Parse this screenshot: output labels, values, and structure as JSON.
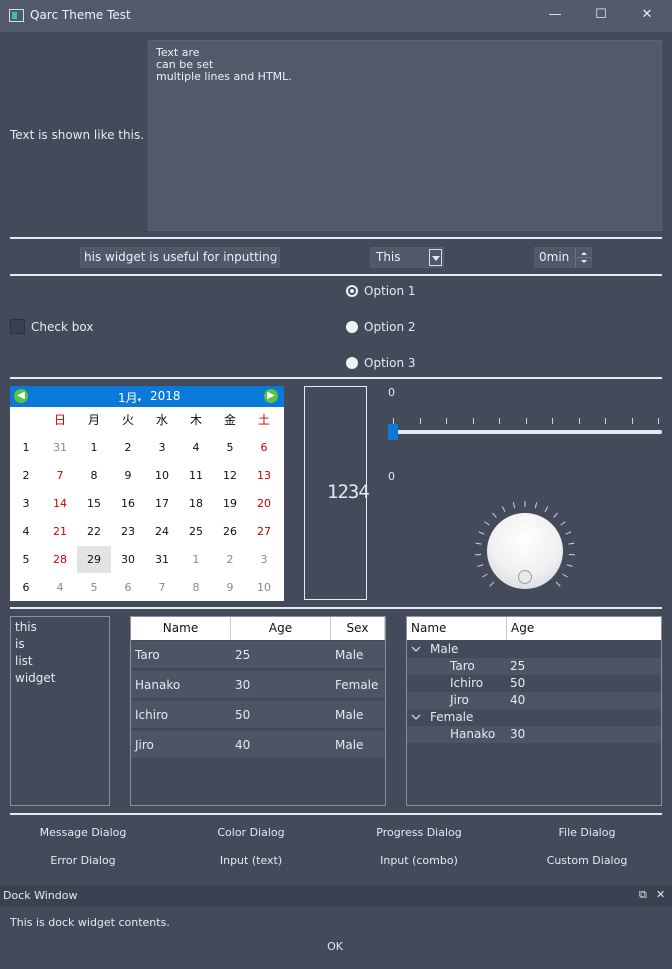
{
  "window": {
    "title": "Qarc Theme Test",
    "minimize": "—",
    "maximize": "☐",
    "close": "✕"
  },
  "label_text": "Text is shown like this.",
  "textedit_value": "Text are\ncan be set\nmultiple lines and HTML.",
  "line_edit_value": "his widget is useful for inputting text",
  "combo_value": "This",
  "spin_value": "0min",
  "checkbox_label": "Check box",
  "checkbox_checked": false,
  "radios": [
    {
      "label": "Option 1",
      "selected": true
    },
    {
      "label": "Option 2",
      "selected": false
    },
    {
      "label": "Option 3",
      "selected": false
    }
  ],
  "calendar": {
    "month": "1月",
    "year": "2018",
    "weekdays": [
      "日",
      "月",
      "火",
      "水",
      "木",
      "金",
      "土"
    ],
    "week_numbers": [
      "1",
      "2",
      "3",
      "4",
      "5",
      "6"
    ],
    "rows": [
      [
        "31",
        "1",
        "2",
        "3",
        "4",
        "5",
        "6"
      ],
      [
        "7",
        "8",
        "9",
        "10",
        "11",
        "12",
        "13"
      ],
      [
        "14",
        "15",
        "16",
        "17",
        "18",
        "19",
        "20"
      ],
      [
        "21",
        "22",
        "23",
        "24",
        "25",
        "26",
        "27"
      ],
      [
        "28",
        "29",
        "30",
        "31",
        "1",
        "2",
        "3"
      ],
      [
        "4",
        "5",
        "6",
        "7",
        "8",
        "9",
        "10"
      ]
    ],
    "selected": "29",
    "weekend_color": "#cc0000",
    "other_month_color": "#8a8a8a"
  },
  "lcd_value": "1234",
  "slider": {
    "label": "0",
    "value": 0
  },
  "dial": {
    "label": "0",
    "value": 0
  },
  "list_items": [
    "this",
    "is",
    "list",
    "widget"
  ],
  "table": {
    "headers": [
      "Name",
      "Age",
      "Sex"
    ],
    "rows": [
      [
        "Taro",
        "25",
        "Male"
      ],
      [
        "Hanako",
        "30",
        "Female"
      ],
      [
        "Ichiro",
        "50",
        "Male"
      ],
      [
        "Jiro",
        "40",
        "Male"
      ]
    ]
  },
  "tree": {
    "headers": [
      "Name",
      "Age"
    ],
    "groups": [
      {
        "name": "Male",
        "children": [
          [
            "Taro",
            "25"
          ],
          [
            "Ichiro",
            "50"
          ],
          [
            "Jiro",
            "40"
          ]
        ]
      },
      {
        "name": "Female",
        "children": [
          [
            "Hanako",
            "30"
          ]
        ]
      }
    ]
  },
  "dialog_buttons": [
    [
      "Message Dialog",
      "Color Dialog",
      "Progress Dialog",
      "File Dialog"
    ],
    [
      "Error Dialog",
      "Input (text)",
      "Input (combo)",
      "Custom Dialog"
    ]
  ],
  "dock": {
    "title": "Dock Window",
    "float_icon": "⧉",
    "close_icon": "✕",
    "content": "This is dock widget contents.",
    "ok_label": "OK"
  },
  "colors": {
    "background": "#434b5a",
    "accent": "#0a79d8"
  }
}
